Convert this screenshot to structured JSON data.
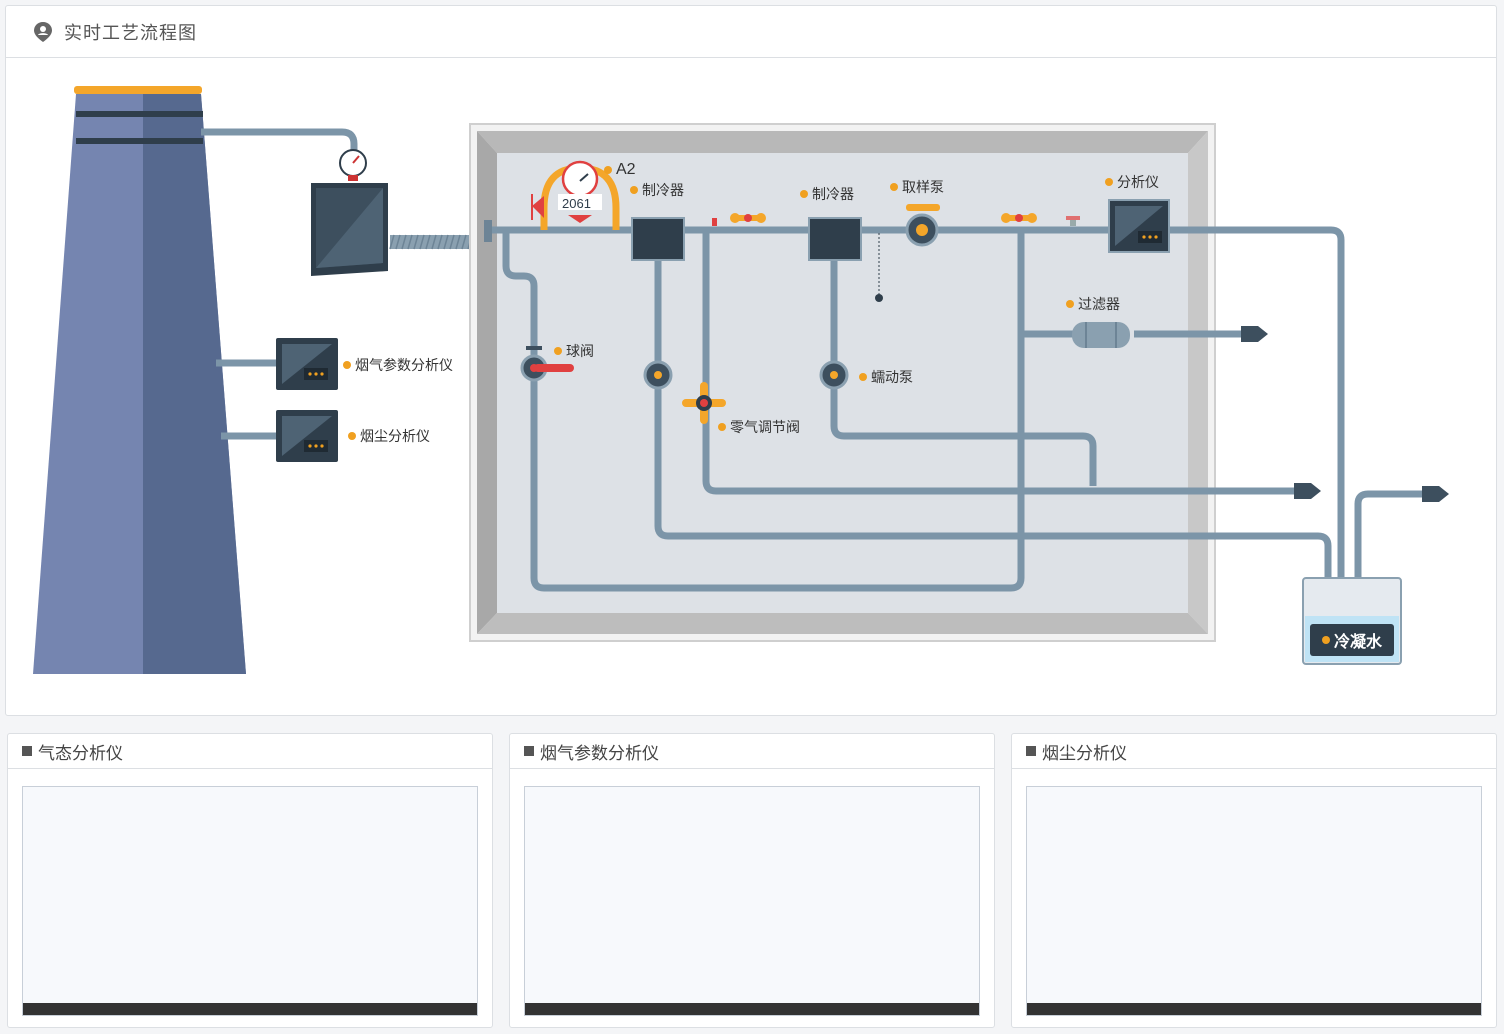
{
  "panel": {
    "title": "实时工艺流程图"
  },
  "diagram_labels": {
    "a2": "A2",
    "gauge_value": "2061",
    "chiller_1": "制冷器",
    "chiller_2": "制冷器",
    "sample_pump": "取样泵",
    "analyzer": "分析仪",
    "filter": "过滤器",
    "ball_valve": "球阀",
    "peristaltic_pump": "蠕动泵",
    "zero_gas_valve": "零气调节阀",
    "flue_gas_analyzer": "烟气参数分析仪",
    "dust_analyzer": "烟尘分析仪",
    "condensate": "冷凝水"
  },
  "cards": [
    {
      "title": "气态分析仪"
    },
    {
      "title": "烟气参数分析仪"
    },
    {
      "title": "烟尘分析仪"
    }
  ],
  "colors": {
    "stack_light": "#7585b0",
    "stack_dark": "#56698f",
    "pipe": "#7c95a8",
    "box": "#2f3e4b",
    "accent": "#f0a020"
  }
}
